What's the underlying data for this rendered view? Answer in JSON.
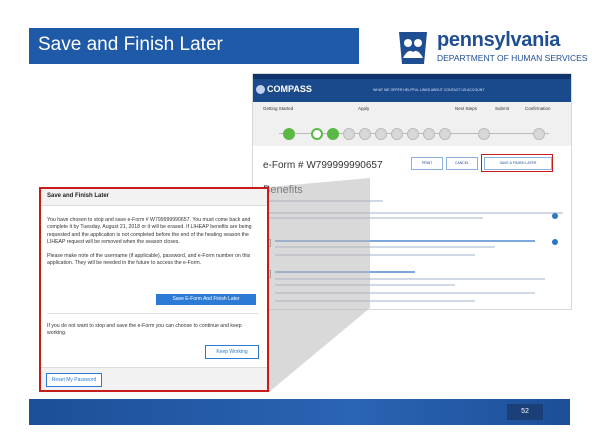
{
  "slide": {
    "title": "Save and Finish Later",
    "page_number": "52",
    "logo": {
      "name": "pennsylvania",
      "subtitle": "DEPARTMENT OF HUMAN SERVICES"
    }
  },
  "site": {
    "brand": "COMPASS",
    "nav_text": "WHAT WE OFFER   HELPFUL LINKS   ABOUT   CONTACT US   ACCOUNT",
    "steps": [
      "Getting Started",
      "Apply",
      "Next Steps",
      "Submit",
      "Confirmation"
    ],
    "eform_number": "e-Form # W799999990657",
    "buttons": {
      "print": "PRINT",
      "cancel": "CANCEL",
      "save_finish": "SAVE & FINISH LATER"
    },
    "benefits_heading": "Benefits"
  },
  "dialog": {
    "title": "Save and Finish Later",
    "paragraph_1": "You have chosen to stop and save e-Form # W799999990657. You must come back and complete it by Tuesday, August 21, 2018 or it will be erased. If LIHEAP benefits are being requested and the application is not completed before the end of the heating season the LIHEAP request will be removed when the season closes.",
    "paragraph_2": "Please make note of the username (if applicable), password, and e-Form number on this application. They will be needed in the future to access the e-Form.",
    "save_button": "Save E-Form And Finish Later",
    "paragraph_3": "If you do not want to stop and save the e-Form you can choose to continue and keep working.",
    "keep_button": "Keep Working",
    "reset_button": "Reset My Password"
  },
  "colors": {
    "accent": "#1f5aa8",
    "highlight": "#c81c1c",
    "button": "#2b7bd6"
  }
}
